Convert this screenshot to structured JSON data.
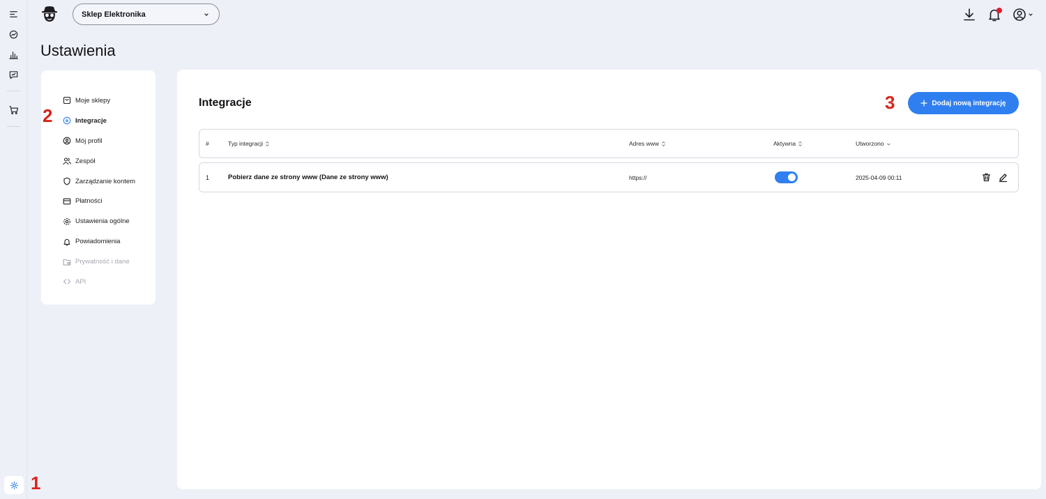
{
  "topbar": {
    "shop_select": "Sklep Elektronika"
  },
  "page": {
    "title": "Ustawienia"
  },
  "settings_nav": {
    "items": [
      {
        "label": "Moje sklepy",
        "icon": "store-icon",
        "state": "normal"
      },
      {
        "label": "Integracje",
        "icon": "cloud-icon",
        "state": "active"
      },
      {
        "label": "Mój profil",
        "icon": "user-circle-icon",
        "state": "normal"
      },
      {
        "label": "Zespół",
        "icon": "team-icon",
        "state": "normal"
      },
      {
        "label": "Zarządzanie kontem",
        "icon": "shield-icon",
        "state": "normal"
      },
      {
        "label": "Płatności",
        "icon": "credit-card-icon",
        "state": "normal"
      },
      {
        "label": "Ustawienia ogólne",
        "icon": "gear-icon",
        "state": "normal"
      },
      {
        "label": "Powiadomienia",
        "icon": "bell-icon",
        "state": "normal"
      },
      {
        "label": "Prywatność i dane",
        "icon": "folder-lock-icon",
        "state": "disabled"
      },
      {
        "label": "API",
        "icon": "code-icon",
        "state": "disabled"
      }
    ]
  },
  "markers": {
    "m1": "1",
    "m2": "2",
    "m3": "3"
  },
  "integrations": {
    "heading": "Integracje",
    "add_button": "Dodaj nową integrację",
    "columns": {
      "num": "#",
      "type": "Typ integracji",
      "url": "Adres www",
      "active": "Aktywna",
      "created": "Utworzono"
    },
    "rows": [
      {
        "num": "1",
        "type": "Pobierz dane ze strony www (Dane ze strony www)",
        "url": "https://",
        "active": true,
        "created": "2025-04-09 00:11"
      }
    ]
  },
  "colors": {
    "accent": "#2f7ff0",
    "background": "#eef0f7",
    "marker": "#d9241a",
    "notification": "#e21b2a"
  }
}
